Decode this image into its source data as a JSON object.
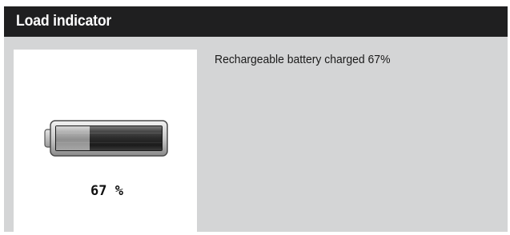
{
  "header": {
    "title": "Load indicator"
  },
  "battery": {
    "charge_percent": 67,
    "label": "67 %",
    "icon": "battery-icon"
  },
  "description": {
    "text": "Rechargeable battery charged 67%"
  },
  "colors": {
    "header_bg": "#1f1f20",
    "header_text": "#ffffff",
    "card_bg": "#d4d5d6",
    "panel_bg": "#ffffff"
  }
}
